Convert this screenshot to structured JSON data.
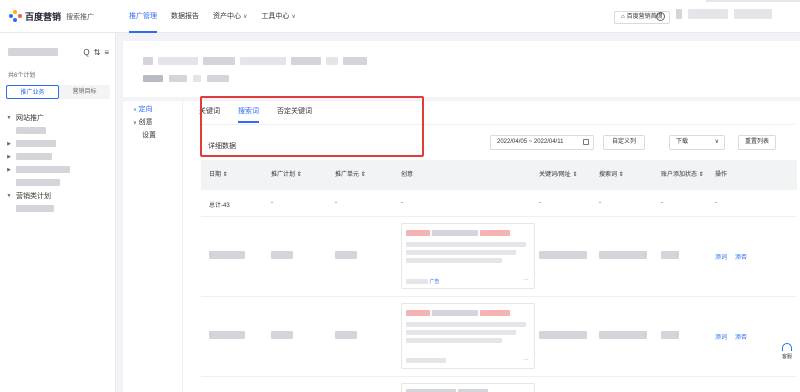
{
  "brand": {
    "name": "百度营销",
    "product": "搜索推广"
  },
  "nav": {
    "items": [
      {
        "label": "推广管理",
        "active": true,
        "dropdown": false
      },
      {
        "label": "数据报告",
        "active": false,
        "dropdown": false
      },
      {
        "label": "资产中心",
        "active": false,
        "dropdown": true
      },
      {
        "label": "工具中心",
        "active": false,
        "dropdown": true
      }
    ],
    "home_button": "百度营销首页"
  },
  "left_panel": {
    "plan_count": "共6个计划",
    "tabs": [
      {
        "label": "推广业务",
        "active": true
      },
      {
        "label": "营销目标",
        "active": false
      }
    ],
    "groups": [
      {
        "label": "网站推广"
      },
      {
        "label": "营销类计划"
      }
    ]
  },
  "subnav": [
    {
      "label": "定向",
      "active": true,
      "caret": "∨"
    },
    {
      "label": "创意",
      "active": false,
      "caret": "∨"
    },
    {
      "label": "设置",
      "active": false,
      "caret": ""
    }
  ],
  "tabs": [
    {
      "label": "关键词",
      "active": false
    },
    {
      "label": "搜索词",
      "active": true
    },
    {
      "label": "否定关键词",
      "active": false
    }
  ],
  "section_title": "详细数据",
  "toolbar": {
    "date_range": "2022/04/05 ~ 2022/04/11",
    "custom_columns": "自定义列",
    "download": "下载",
    "reset_columns": "重置列表"
  },
  "table": {
    "columns": [
      "日期",
      "推广计划",
      "推广单元",
      "创意",
      "关键词/网址",
      "搜索词",
      "账户添加状态",
      "操作"
    ],
    "total_row": {
      "date": "总计-43",
      "dash": "-"
    },
    "row_actions": [
      "添词",
      "添否"
    ],
    "card_footer_brand": "广告"
  },
  "float_button": "客服",
  "colors": {
    "accent": "#2e6bf6",
    "highlight": "#e33a3a",
    "background": "#f2f3f6"
  }
}
